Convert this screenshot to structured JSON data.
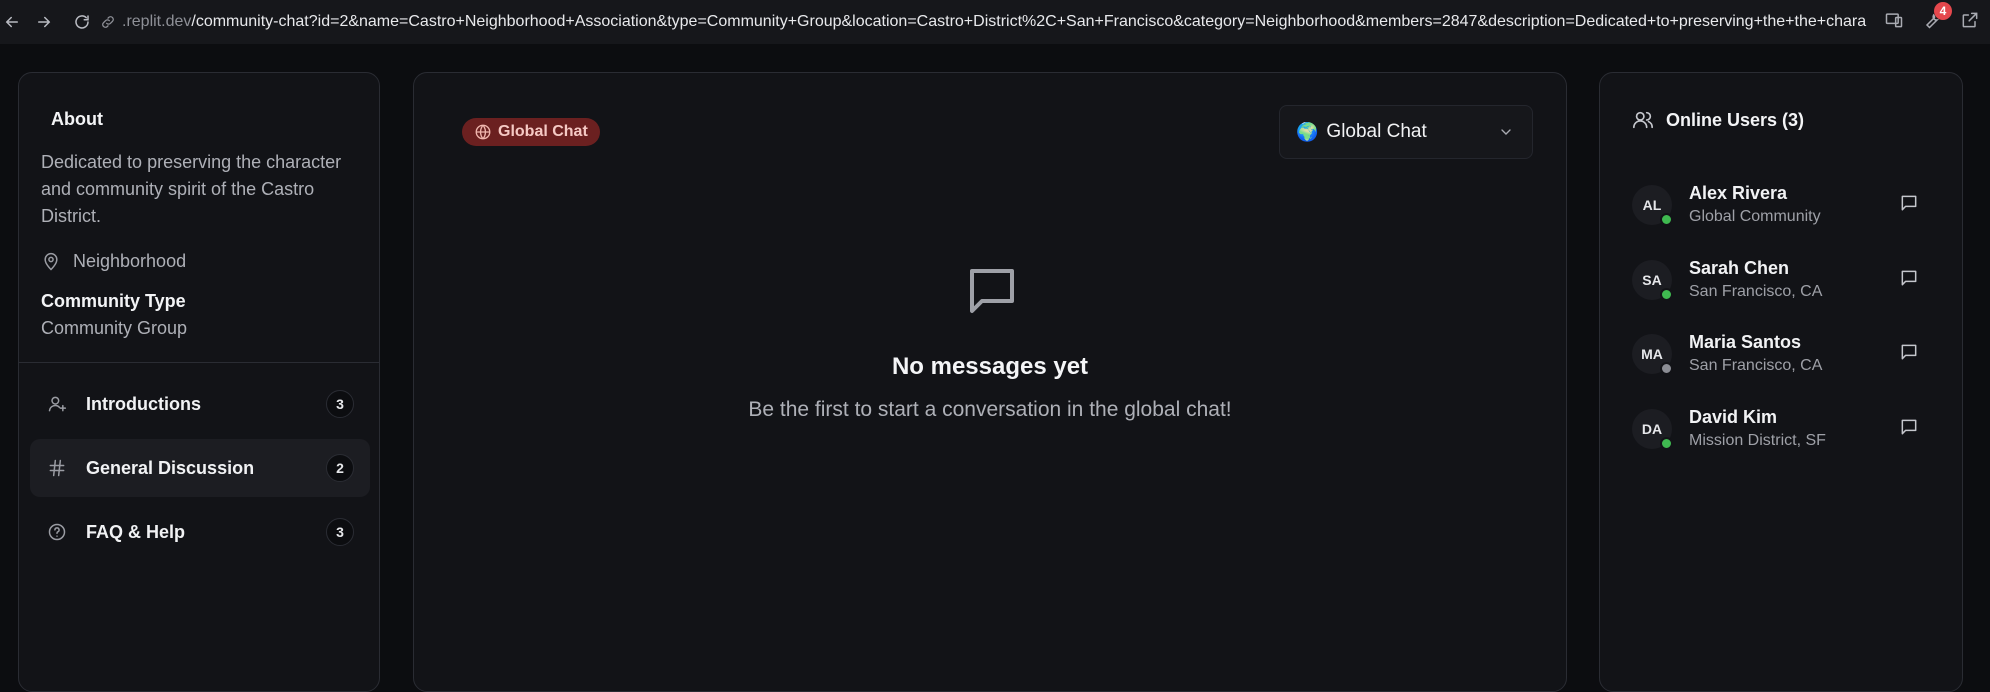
{
  "browser": {
    "url_host": ".replit.dev",
    "url_path": "/community-chat?id=2&name=Castro+Neighborhood+Association&type=Community+Group&location=Castro+District%2C+San+Francisco&category=Neighborhood&members=2847&description=Dedicated+to+preserving+the+the+chara",
    "notification_count": "4"
  },
  "sidebar": {
    "about_title": "About",
    "description": "Dedicated to preserving the character and community spirit of the Castro District.",
    "category": "Neighborhood",
    "community_type_label": "Community Type",
    "community_type_value": "Community Group",
    "channels": [
      {
        "label": "Introductions",
        "count": "3",
        "icon": "user-plus-icon"
      },
      {
        "label": "General Discussion",
        "count": "2",
        "icon": "hash-icon"
      },
      {
        "label": "FAQ & Help",
        "count": "3",
        "icon": "help-circle-icon"
      }
    ]
  },
  "main": {
    "badge_label": "Global Chat",
    "selector_emoji": "🌍",
    "selector_label": "Global Chat",
    "empty_title": "No messages yet",
    "empty_subtitle": "Be the first to start a conversation in the global chat!"
  },
  "online": {
    "title": "Online Users (3)",
    "users": [
      {
        "initials": "AL",
        "name": "Alex Rivera",
        "location": "Global Community",
        "status_color": "#3fb950"
      },
      {
        "initials": "SA",
        "name": "Sarah Chen",
        "location": "San Francisco, CA",
        "status_color": "#3fb950"
      },
      {
        "initials": "MA",
        "name": "Maria Santos",
        "location": "San Francisco, CA",
        "status_color": "#8b8d94"
      },
      {
        "initials": "DA",
        "name": "David Kim",
        "location": "Mission District, SF",
        "status_color": "#3fb950"
      }
    ]
  },
  "colors": {
    "accent_badge_bg": "#6b2020",
    "online": "#3fb950",
    "offline": "#8b8d94"
  }
}
